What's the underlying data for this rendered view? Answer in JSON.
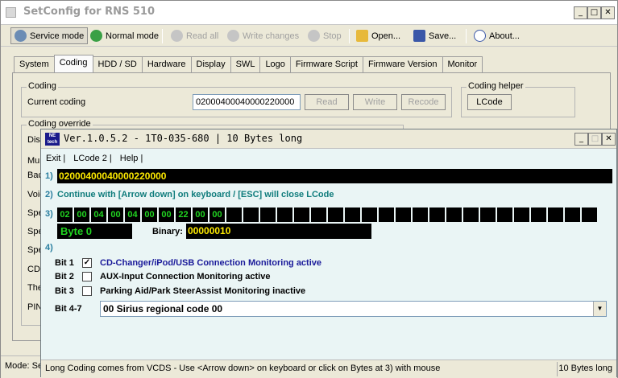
{
  "window": {
    "title": "SetConfig for RNS 510"
  },
  "toolbar": {
    "service_mode": "Service mode",
    "normal_mode": "Normal mode",
    "read_all": "Read all",
    "write_changes": "Write changes",
    "stop": "Stop",
    "open": "Open...",
    "save": "Save...",
    "about": "About..."
  },
  "tabs": [
    "System",
    "Coding",
    "HDD / SD",
    "Hardware",
    "Display",
    "SWL",
    "Logo",
    "Firmware Script",
    "Firmware Version",
    "Monitor"
  ],
  "coding": {
    "group_label": "Coding",
    "current_label": "Current coding",
    "current_value": "02000400040000220000",
    "read": "Read",
    "write": "Write",
    "recode": "Recode",
    "helper_label": "Coding helper",
    "lcode": "LCode",
    "override_label": "Coding override",
    "override_rows": [
      "Disp",
      "Mul",
      "Bac",
      "Voic",
      "Spe",
      "Spe",
      "Spe",
      "CD",
      "The",
      "PIN"
    ]
  },
  "status": {
    "mode": "Mode: Se"
  },
  "dialog": {
    "logo_text": "NE-\ntech",
    "title": "Ver.1.0.5.2 -  1T0-035-680 | 10 Bytes long",
    "menu": [
      "Exit |",
      "LCode 2 |",
      "Help |"
    ],
    "row1_label": "1)",
    "row1_code": "02000400040000220000",
    "row2_label": "2)",
    "row2_text": "Continue with [Arrow down] on keyboard / [ESC] will close LCode",
    "row3_label": "3)",
    "bytes": [
      "02",
      "00",
      "04",
      "00",
      "04",
      "00",
      "00",
      "22",
      "00",
      "00",
      "",
      "",
      "",
      "",
      "",
      "",
      "",
      "",
      "",
      "",
      "",
      "",
      "",
      "",
      "",
      "",
      "",
      "",
      "",
      "",
      "",
      ""
    ],
    "byte_selected": "Byte 0",
    "binary_label": "Binary:",
    "binary_value": "00000010",
    "row4_label": "4)",
    "bits": [
      {
        "label": "Bit 1",
        "checked": true,
        "text": "CD-Changer/iPod/USB Connection Monitoring active"
      },
      {
        "label": "Bit 2",
        "checked": false,
        "text": "AUX-Input Connection Monitoring active"
      },
      {
        "label": "Bit 3",
        "checked": false,
        "text": "Parking Aid/Park SteerAssist Monitoring inactive"
      }
    ],
    "bit47_label": "Bit 4-7",
    "bit47_value": "00 Sirius regional code 00",
    "status_left": "Long Coding comes from VCDS - Use <Arrow down> on keyboard or click on Bytes at 3) with mouse",
    "status_right": "10 Bytes long"
  },
  "colors": {
    "byte_green": "#21d421",
    "code_yellow": "#ffeb00",
    "hint_teal": "#0f7c7c",
    "dialog_bg": "#eaf5f5"
  }
}
